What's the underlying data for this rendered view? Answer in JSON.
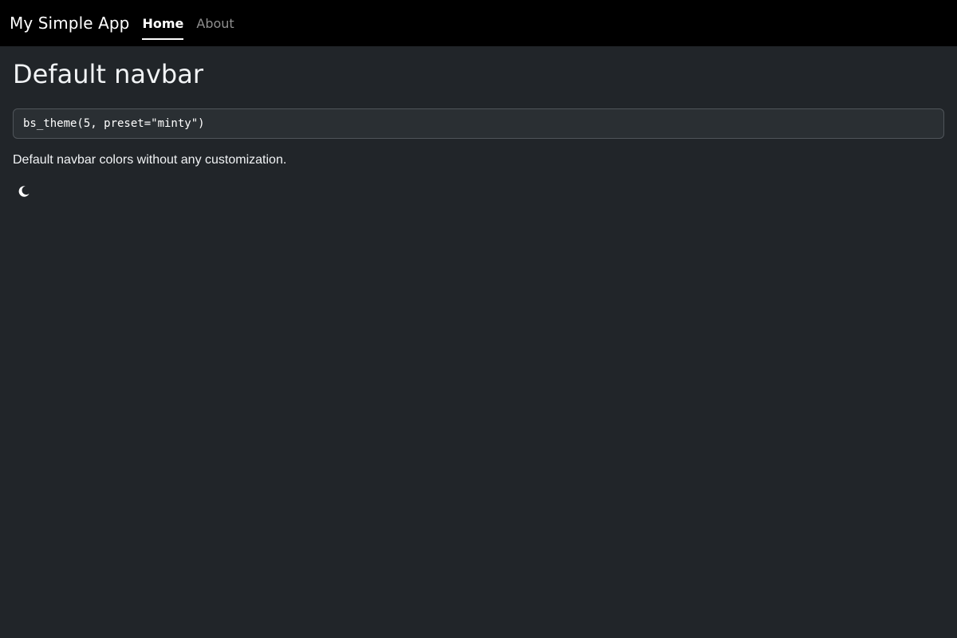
{
  "navbar": {
    "brand": "My Simple App",
    "items": [
      {
        "label": "Home",
        "active": true
      },
      {
        "label": "About",
        "active": false
      }
    ]
  },
  "main": {
    "title": "Default navbar",
    "code": "bs_theme(5, preset=\"minty\")",
    "description": "Default navbar colors without any customization.",
    "toggle_icon": "moon-icon"
  },
  "colors": {
    "navbar_bg": "#000000",
    "page_bg": "#212529",
    "text": "#f8f9fa",
    "muted_link": "#8f8f8f"
  }
}
